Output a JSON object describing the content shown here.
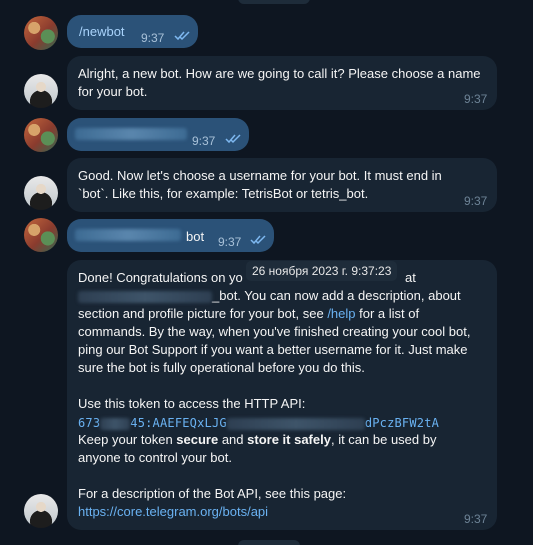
{
  "messages": [
    {
      "text": "/newbot",
      "time": "9:37"
    },
    {
      "line1": "Alright, a new bot. How are we going to call it? Please choose a name",
      "line2": "for your bot.",
      "time": "9:37"
    },
    {
      "time": "9:37"
    },
    {
      "line1": "Good. Now let's choose a username for your bot. It must end in",
      "line2": "`bot`. Like this, for example: TetrisBot or tetris_bot.",
      "time": "9:37"
    },
    {
      "suffix": "bot",
      "time": "9:37"
    },
    {
      "l1a": "Done! Congratulations on yo",
      "l1b": "at",
      "l2": "_bot. You can now add a description, about",
      "l3a": "section and profile picture for your bot, see ",
      "l3link": "/help",
      "l3b": " for a list of",
      "l4": "commands. By the way, when you've finished creating your cool bot,",
      "l5": "ping our Bot Support if you want a better username for it. Just make",
      "l6": "sure the bot is fully operational before you do this.",
      "l7": "Use this token to access the HTTP API:",
      "token_a": "673",
      "token_b": "45:AAEFEQxLJG",
      "token_c": "dPczBFW2tA",
      "l9a": "Keep your token ",
      "l9b": "secure",
      "l9c": " and ",
      "l9d": "store it safely",
      "l9e": ", it can be used by",
      "l10": "anyone to control your bot.",
      "l11": "For a description of the Bot API, see this page:",
      "link": "https://core.telegram.org/bots/api",
      "time": "9:37"
    }
  ],
  "date_tooltip": "26 ноября 2023 г. 9:37:23",
  "colors": {
    "incoming": "#182533",
    "outgoing": "#2b5278",
    "background": "#0e1621",
    "link": "#6ab2f2"
  }
}
